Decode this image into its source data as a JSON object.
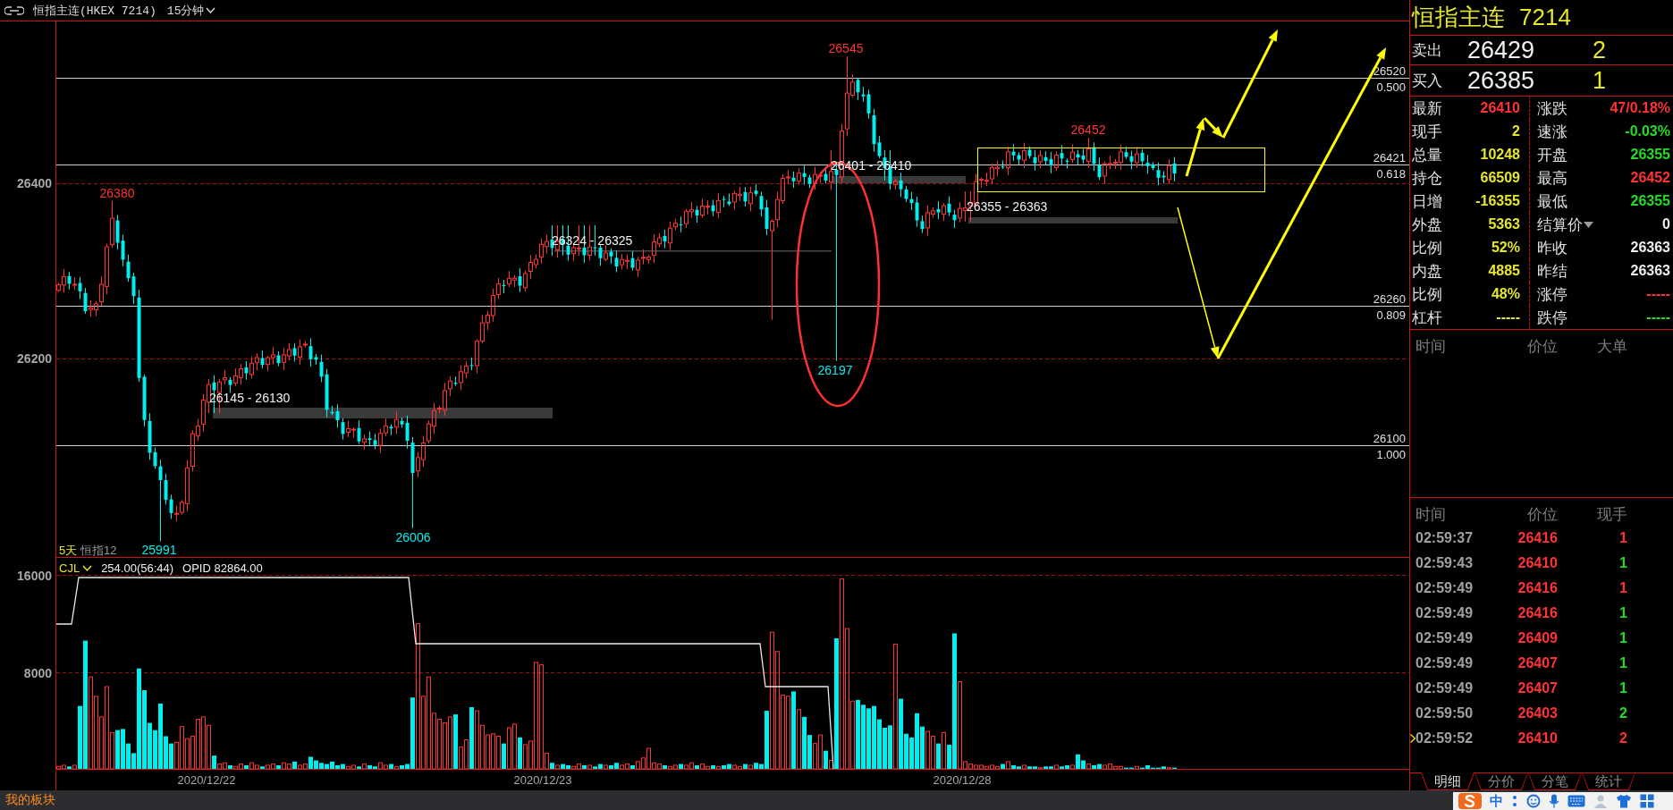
{
  "header": {
    "title": "恒指主连(HKEX 7214)",
    "period": "15分钟"
  },
  "price_chart": {
    "y_ticks": [
      "26400",
      "26200"
    ],
    "fib_levels": [
      {
        "price": "26520",
        "ratio": "0.500"
      },
      {
        "price": "26421",
        "ratio": "0.618"
      },
      {
        "price": "26260",
        "ratio": "0.809"
      },
      {
        "price": "26100",
        "ratio": "1.000"
      }
    ],
    "extremes": [
      {
        "kind": "high",
        "value": "26380"
      },
      {
        "kind": "low",
        "value": "25991"
      },
      {
        "kind": "low",
        "value": "26006"
      },
      {
        "kind": "low",
        "value": "26197"
      },
      {
        "kind": "high",
        "value": "26545"
      },
      {
        "kind": "high",
        "value": "26452"
      }
    ],
    "zones": [
      "26145 - 26130",
      "26324 - 26325",
      "26401 - 26410",
      "26355 - 26363"
    ],
    "legend": [
      "5天",
      "恒指12"
    ]
  },
  "volume_chart": {
    "indicator": "CJL",
    "readout": "254.00(56:44)",
    "opid": "OPID 82864.00",
    "y_ticks": [
      "16000",
      "8000"
    ],
    "dates": [
      "2020/12/22",
      "2020/12/23",
      "2020/12/28"
    ]
  },
  "quote": {
    "name": "恒指主连",
    "code": "7214",
    "book": [
      {
        "label": "卖出",
        "price": "26429",
        "size": "2"
      },
      {
        "label": "买入",
        "price": "26385",
        "size": "1"
      }
    ],
    "stats": [
      {
        "label": "最新",
        "value": "26410",
        "color": "#ff3333",
        "kind": "value"
      },
      {
        "label": "涨跌",
        "value": "47/0.18%",
        "color": "#ff3333",
        "kind": "value"
      },
      {
        "label": "现手",
        "value": "2",
        "color": "#e6e62e",
        "kind": "value"
      },
      {
        "label": "速涨",
        "value": "-0.03%",
        "color": "#22dd22",
        "kind": "value"
      },
      {
        "label": "总量",
        "value": "10248",
        "color": "#e6e62e",
        "kind": "value"
      },
      {
        "label": "开盘",
        "value": "26355",
        "color": "#22dd22",
        "kind": "value"
      },
      {
        "label": "持仓",
        "value": "66509",
        "color": "#e6e62e",
        "kind": "value"
      },
      {
        "label": "最高",
        "value": "26452",
        "color": "#ff3333",
        "kind": "value"
      },
      {
        "label": "日增",
        "value": "-16355",
        "color": "#e6e62e",
        "kind": "value"
      },
      {
        "label": "最低",
        "value": "26355",
        "color": "#22dd22",
        "kind": "value"
      },
      {
        "label": "外盘",
        "value": "5363",
        "color": "#e6e62e",
        "kind": "value"
      },
      {
        "label": "结算价",
        "value": "0",
        "color": "#eeeeee",
        "kind": "select"
      },
      {
        "label": "比例",
        "value": "52%",
        "color": "#e6e62e",
        "kind": "value"
      },
      {
        "label": "昨收",
        "value": "26363",
        "color": "#eeeeee",
        "kind": "value"
      },
      {
        "label": "内盘",
        "value": "4885",
        "color": "#e6e62e",
        "kind": "value"
      },
      {
        "label": "昨结",
        "value": "26363",
        "color": "#eeeeee",
        "kind": "value"
      },
      {
        "label": "比例",
        "value": "48%",
        "color": "#e6e62e",
        "kind": "value"
      },
      {
        "label": "涨停",
        "value": "-----",
        "color": "#ff3333",
        "kind": "value"
      },
      {
        "label": "杠杆",
        "value": "-----",
        "color": "#e6e62e",
        "kind": "value"
      },
      {
        "label": "跌停",
        "value": "-----",
        "color": "#22dd22",
        "kind": "value"
      }
    ]
  },
  "big_orders": {
    "columns": [
      "时间",
      "价位",
      "大单"
    ]
  },
  "trades": {
    "columns": [
      "时间",
      "价位",
      "现手"
    ],
    "rows": [
      {
        "time": "02:59:37",
        "price": {
          "value": "26416",
          "color": "#ff3333"
        },
        "qty": {
          "value": "1",
          "color": "#ff3333"
        },
        "selected": false
      },
      {
        "time": "02:59:43",
        "price": {
          "value": "26410",
          "color": "#ff3333"
        },
        "qty": {
          "value": "1",
          "color": "#22dd22"
        },
        "selected": false
      },
      {
        "time": "02:59:49",
        "price": {
          "value": "26416",
          "color": "#ff3333"
        },
        "qty": {
          "value": "1",
          "color": "#ff3333"
        },
        "selected": false
      },
      {
        "time": "02:59:49",
        "price": {
          "value": "26416",
          "color": "#ff3333"
        },
        "qty": {
          "value": "1",
          "color": "#22dd22"
        },
        "selected": false
      },
      {
        "time": "02:59:49",
        "price": {
          "value": "26409",
          "color": "#ff3333"
        },
        "qty": {
          "value": "1",
          "color": "#22dd22"
        },
        "selected": false
      },
      {
        "time": "02:59:49",
        "price": {
          "value": "26407",
          "color": "#ff3333"
        },
        "qty": {
          "value": "1",
          "color": "#22dd22"
        },
        "selected": false
      },
      {
        "time": "02:59:49",
        "price": {
          "value": "26407",
          "color": "#ff3333"
        },
        "qty": {
          "value": "1",
          "color": "#22dd22"
        },
        "selected": false
      },
      {
        "time": "02:59:50",
        "price": {
          "value": "26403",
          "color": "#ff3333"
        },
        "qty": {
          "value": "2",
          "color": "#22dd22"
        },
        "selected": false
      },
      {
        "time": "02:59:52",
        "price": {
          "value": "26410",
          "color": "#ff3333"
        },
        "qty": {
          "value": "2",
          "color": "#ff3333"
        },
        "selected": true
      }
    ]
  },
  "tabs": [
    {
      "label": "明细",
      "selected": true
    },
    {
      "label": "分价",
      "selected": false
    },
    {
      "label": "分笔",
      "selected": false
    },
    {
      "label": "统计",
      "selected": false
    }
  ],
  "taskbar": {
    "label": "我的板块"
  },
  "ime": {
    "mode": "中"
  }
}
